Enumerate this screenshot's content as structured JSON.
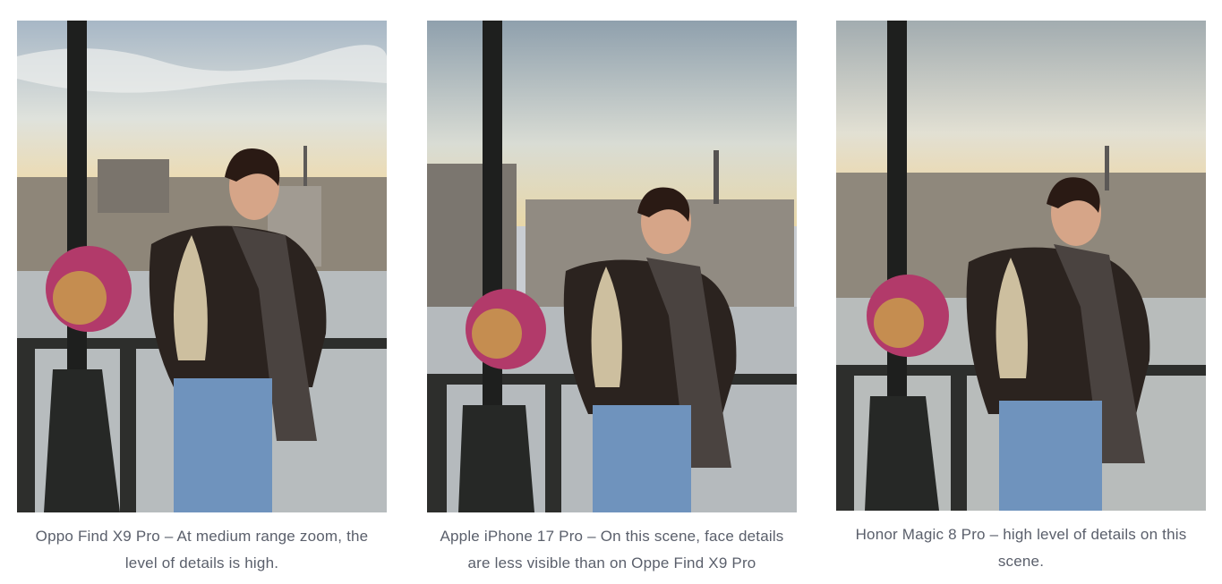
{
  "gallery": {
    "items": [
      {
        "caption": "Oppo Find X9 Pro – At medium range zoom, the level of details is high."
      },
      {
        "caption": "Apple iPhone 17 Pro – On this scene, face details are less visible than on Oppe Find X9 Pro"
      },
      {
        "caption": "Honor Magic 8 Pro – high level of details on this scene."
      }
    ]
  },
  "colors": {
    "caption_text": "#5a5f6b",
    "sky_top": "#9fb0c0",
    "sky_bottom": "#f1dca8",
    "river": "#b9bfc2",
    "jacket": "#2b231f",
    "scarf": "#4a4340",
    "jeans": "#6f93bd"
  }
}
